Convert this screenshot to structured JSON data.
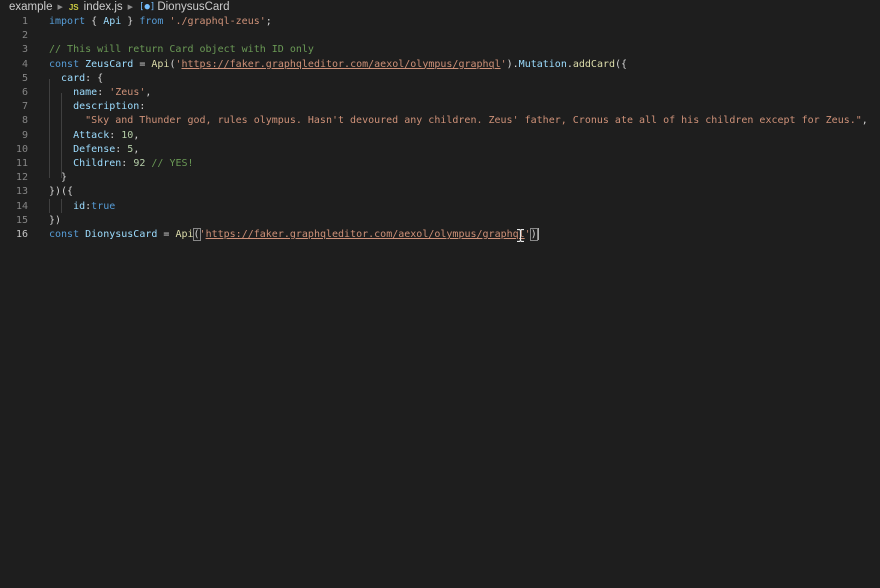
{
  "breadcrumb": {
    "folder": "example",
    "file_badge": "JS",
    "file": "index.js",
    "symbol": "DionysusCard"
  },
  "editor": {
    "active_line": 16,
    "lines": [
      {
        "n": "1",
        "tokens": [
          [
            "kw",
            "import"
          ],
          [
            "plain",
            " { "
          ],
          [
            "var",
            "Api"
          ],
          [
            "plain",
            " } "
          ],
          [
            "kw",
            "from"
          ],
          [
            "plain",
            " "
          ],
          [
            "str",
            "'./graphql-zeus'"
          ],
          [
            "plain",
            ";"
          ]
        ]
      },
      {
        "n": "2",
        "tokens": []
      },
      {
        "n": "3",
        "tokens": [
          [
            "cm",
            "// This will return Card object with ID only"
          ]
        ]
      },
      {
        "n": "4",
        "tokens": [
          [
            "kw",
            "const"
          ],
          [
            "plain",
            " "
          ],
          [
            "var",
            "ZeusCard"
          ],
          [
            "plain",
            " = "
          ],
          [
            "fn",
            "Api"
          ],
          [
            "plain",
            "("
          ],
          [
            "str",
            "'"
          ],
          [
            "url",
            "https://faker.graphqleditor.com/aexol/olympus/graphql"
          ],
          [
            "str",
            "'"
          ],
          [
            "plain",
            ")."
          ],
          [
            "var",
            "Mutation"
          ],
          [
            "plain",
            "."
          ],
          [
            "fn",
            "addCard"
          ],
          [
            "plain",
            "({"
          ]
        ]
      },
      {
        "n": "5",
        "tokens": [
          [
            "plain",
            "  "
          ],
          [
            "prop",
            "card"
          ],
          [
            "plain",
            ": {"
          ]
        ]
      },
      {
        "n": "6",
        "tokens": [
          [
            "plain",
            "    "
          ],
          [
            "prop",
            "name"
          ],
          [
            "plain",
            ": "
          ],
          [
            "str",
            "'Zeus'"
          ],
          [
            "plain",
            ","
          ]
        ]
      },
      {
        "n": "7",
        "tokens": [
          [
            "plain",
            "    "
          ],
          [
            "prop",
            "description"
          ],
          [
            "plain",
            ":"
          ]
        ]
      },
      {
        "n": "8",
        "tokens": [
          [
            "plain",
            "      "
          ],
          [
            "str",
            "\"Sky and Thunder god, rules olympus. Hasn't devoured any children. Zeus' father, Cronus ate all of his children except for Zeus.\""
          ],
          [
            "plain",
            ","
          ]
        ]
      },
      {
        "n": "9",
        "tokens": [
          [
            "plain",
            "    "
          ],
          [
            "prop",
            "Attack"
          ],
          [
            "plain",
            ": "
          ],
          [
            "num",
            "10"
          ],
          [
            "plain",
            ","
          ]
        ]
      },
      {
        "n": "10",
        "tokens": [
          [
            "plain",
            "    "
          ],
          [
            "prop",
            "Defense"
          ],
          [
            "plain",
            ": "
          ],
          [
            "num",
            "5"
          ],
          [
            "plain",
            ","
          ]
        ]
      },
      {
        "n": "11",
        "tokens": [
          [
            "plain",
            "    "
          ],
          [
            "prop",
            "Children"
          ],
          [
            "plain",
            ": "
          ],
          [
            "num",
            "92"
          ],
          [
            "plain",
            " "
          ],
          [
            "cm",
            "// YES!"
          ]
        ]
      },
      {
        "n": "12",
        "tokens": [
          [
            "plain",
            "  }"
          ]
        ]
      },
      {
        "n": "13",
        "tokens": [
          [
            "plain",
            "})({"
          ]
        ]
      },
      {
        "n": "14",
        "tokens": [
          [
            "plain",
            "    "
          ],
          [
            "prop",
            "id"
          ],
          [
            "plain",
            ":"
          ],
          [
            "bool",
            "true"
          ]
        ]
      },
      {
        "n": "15",
        "tokens": [
          [
            "plain",
            "})"
          ]
        ]
      },
      {
        "n": "16",
        "tokens": [
          [
            "kw",
            "const"
          ],
          [
            "plain",
            " "
          ],
          [
            "var",
            "DionysusCard"
          ],
          [
            "plain",
            " = "
          ],
          [
            "fn",
            "Api"
          ],
          [
            "hl",
            "("
          ],
          [
            "str",
            "'"
          ],
          [
            "url",
            "https://faker.graphqleditor.com/aexol/olympus/graphql"
          ],
          [
            "str",
            "'"
          ],
          [
            "hl",
            ")"
          ]
        ]
      }
    ]
  },
  "icons": {
    "breadcrumb_separator": "chevron-right-icon",
    "symbol": "variable-symbol-icon",
    "mouse_pointer": "text-cursor-ibeam-icon"
  },
  "colors": {
    "background": "#1e1e1e",
    "keyword": "#569cd6",
    "string": "#ce9178",
    "comment": "#6a9955",
    "function": "#dcdcaa",
    "variable": "#9cdcfe",
    "number": "#b5cea8"
  }
}
